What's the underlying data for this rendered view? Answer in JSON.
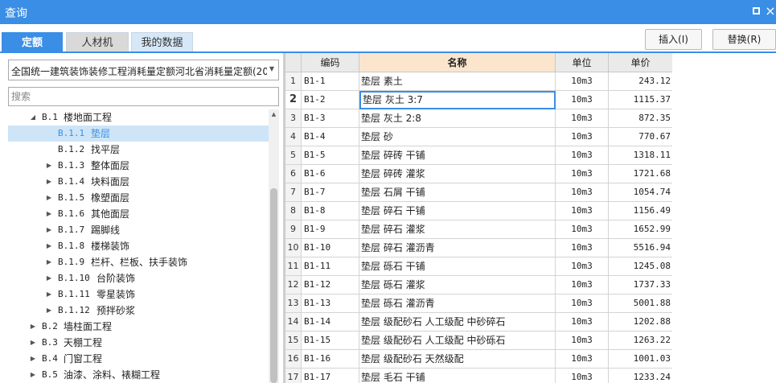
{
  "window": {
    "title": "查询"
  },
  "tabs": [
    "定额",
    "人材机",
    "我的数据"
  ],
  "buttons": {
    "insert": "插入(I)",
    "replace": "替换(R)"
  },
  "quota_select": {
    "value": "全国统一建筑装饰装修工程消耗量定额河北省消耗量定额(20"
  },
  "search": {
    "placeholder": "搜索"
  },
  "tree": [
    {
      "code": "B.1",
      "name": "楼地面工程",
      "level": 1,
      "toggle": "expanded",
      "selected": false
    },
    {
      "code": "B.1.1",
      "name": "垫层",
      "level": 2,
      "toggle": "none",
      "selected": true
    },
    {
      "code": "B.1.2",
      "name": "找平层",
      "level": 2,
      "toggle": "none",
      "selected": false
    },
    {
      "code": "B.1.3",
      "name": "整体面层",
      "level": 2,
      "toggle": "collapsed",
      "selected": false
    },
    {
      "code": "B.1.4",
      "name": "块料面层",
      "level": 2,
      "toggle": "collapsed",
      "selected": false
    },
    {
      "code": "B.1.5",
      "name": "橡塑面层",
      "level": 2,
      "toggle": "collapsed",
      "selected": false
    },
    {
      "code": "B.1.6",
      "name": "其他面层",
      "level": 2,
      "toggle": "collapsed",
      "selected": false
    },
    {
      "code": "B.1.7",
      "name": "踢脚线",
      "level": 2,
      "toggle": "collapsed",
      "selected": false
    },
    {
      "code": "B.1.8",
      "name": "楼梯装饰",
      "level": 2,
      "toggle": "collapsed",
      "selected": false
    },
    {
      "code": "B.1.9",
      "name": "栏杆、栏板、扶手装饰",
      "level": 2,
      "toggle": "collapsed",
      "selected": false
    },
    {
      "code": "B.1.10",
      "name": "台阶装饰",
      "level": 2,
      "toggle": "collapsed",
      "selected": false
    },
    {
      "code": "B.1.11",
      "name": "零星装饰",
      "level": 2,
      "toggle": "collapsed",
      "selected": false
    },
    {
      "code": "B.1.12",
      "name": "预拌砂浆",
      "level": 2,
      "toggle": "collapsed",
      "selected": false
    },
    {
      "code": "B.2",
      "name": "墙柱面工程",
      "level": 1,
      "toggle": "collapsed",
      "selected": false
    },
    {
      "code": "B.3",
      "name": "天棚工程",
      "level": 1,
      "toggle": "collapsed",
      "selected": false
    },
    {
      "code": "B.4",
      "name": "门窗工程",
      "level": 1,
      "toggle": "collapsed",
      "selected": false
    },
    {
      "code": "B.5",
      "name": "油漆、涂料、裱糊工程",
      "level": 1,
      "toggle": "collapsed",
      "selected": false
    }
  ],
  "table": {
    "headers": {
      "code": "编码",
      "name": "名称",
      "unit": "单位",
      "price": "单价"
    },
    "rows": [
      {
        "num": "1",
        "code": "B1-1",
        "name": "垫层 素土",
        "unit": "10m3",
        "price": "243.12"
      },
      {
        "num": "2",
        "code": "B1-2",
        "name": "垫层 灰土 3:7",
        "unit": "10m3",
        "price": "1115.37"
      },
      {
        "num": "3",
        "code": "B1-3",
        "name": "垫层 灰土 2:8",
        "unit": "10m3",
        "price": "872.35"
      },
      {
        "num": "4",
        "code": "B1-4",
        "name": "垫层 砂",
        "unit": "10m3",
        "price": "770.67"
      },
      {
        "num": "5",
        "code": "B1-5",
        "name": "垫层 碎砖 干铺",
        "unit": "10m3",
        "price": "1318.11"
      },
      {
        "num": "6",
        "code": "B1-6",
        "name": "垫层 碎砖 灌浆",
        "unit": "10m3",
        "price": "1721.68"
      },
      {
        "num": "7",
        "code": "B1-7",
        "name": "垫层 石屑 干铺",
        "unit": "10m3",
        "price": "1054.74"
      },
      {
        "num": "8",
        "code": "B1-8",
        "name": "垫层 碎石 干铺",
        "unit": "10m3",
        "price": "1156.49"
      },
      {
        "num": "9",
        "code": "B1-9",
        "name": "垫层 碎石 灌浆",
        "unit": "10m3",
        "price": "1652.99"
      },
      {
        "num": "10",
        "code": "B1-10",
        "name": "垫层 碎石 灌沥青",
        "unit": "10m3",
        "price": "5516.94"
      },
      {
        "num": "11",
        "code": "B1-11",
        "name": "垫层 砾石 干铺",
        "unit": "10m3",
        "price": "1245.08"
      },
      {
        "num": "12",
        "code": "B1-12",
        "name": "垫层 砾石 灌浆",
        "unit": "10m3",
        "price": "1737.33"
      },
      {
        "num": "13",
        "code": "B1-13",
        "name": "垫层 砾石 灌沥青",
        "unit": "10m3",
        "price": "5001.88"
      },
      {
        "num": "14",
        "code": "B1-14",
        "name": "垫层 级配砂石 人工级配 中砂碎石",
        "unit": "10m3",
        "price": "1202.88"
      },
      {
        "num": "15",
        "code": "B1-15",
        "name": "垫层 级配砂石 人工级配 中砂砾石",
        "unit": "10m3",
        "price": "1263.22"
      },
      {
        "num": "16",
        "code": "B1-16",
        "name": "垫层 级配砂石 天然级配",
        "unit": "10m3",
        "price": "1001.03"
      },
      {
        "num": "17",
        "code": "B1-17",
        "name": "垫层 毛石 干铺",
        "unit": "10m3",
        "price": "1233.24"
      }
    ]
  }
}
